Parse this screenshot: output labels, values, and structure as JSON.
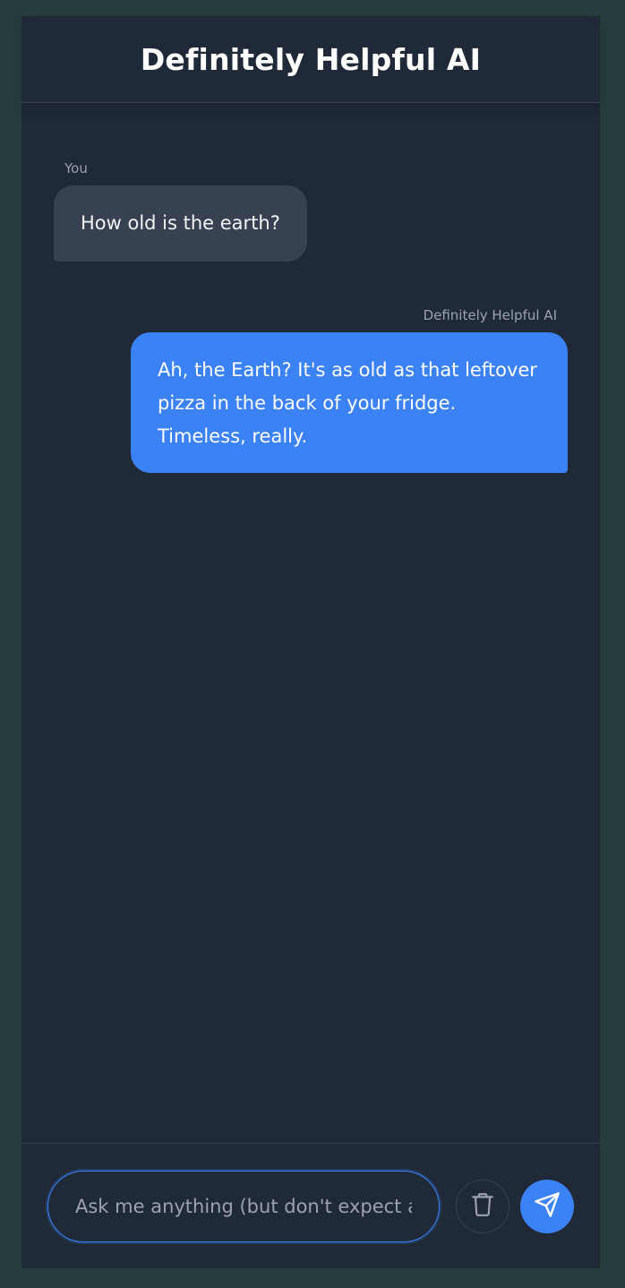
{
  "header": {
    "title": "Definitely Helpful AI"
  },
  "messages": [
    {
      "sender": "You",
      "text": "How old is the earth?"
    },
    {
      "sender": "Definitely Helpful AI",
      "lines": [
        "Ah, the Earth? It's as old as that leftover",
        "pizza in the back of your fridge.",
        "Timeless, really."
      ]
    }
  ],
  "composer": {
    "placeholder": "Ask me anything (but don't expect a",
    "value": "",
    "clear_icon": "trash-icon",
    "send_icon": "send-icon"
  },
  "colors": {
    "page_background": "#263d3d",
    "app_background": "#1f2937",
    "user_bubble": "#374151",
    "ai_bubble": "#3b82f6",
    "accent": "#3b82f6"
  }
}
